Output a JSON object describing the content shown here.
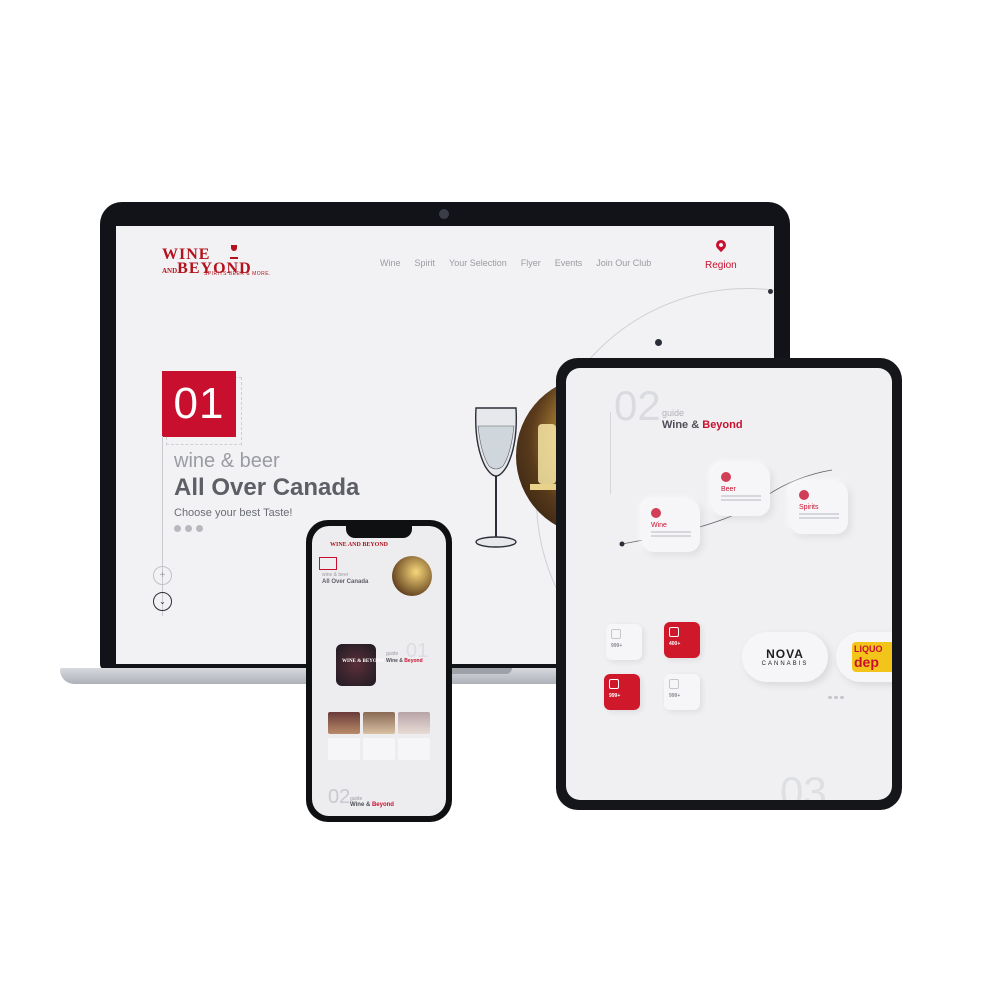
{
  "laptop": {
    "logo": {
      "line1": "WINE",
      "and": "AND",
      "line2": "BEYOND",
      "tagline": "SPIRITS BEER & MORE."
    },
    "nav": [
      "Wine",
      "Spirit",
      "Your Selection",
      "Flyer",
      "Events",
      "Join Our Club"
    ],
    "region_label": "Region",
    "hero": {
      "number": "01",
      "subtitle": "wine & beer",
      "title": "All Over Canada",
      "tagline": "Choose your best Taste!"
    },
    "scroll_up": "+",
    "scroll_down": "⌄",
    "accent": "#c8102e"
  },
  "tablet": {
    "section_number": "02",
    "guide_label": "guide",
    "title_prefix": "Wine & ",
    "title_accent": "Beyond",
    "categories": [
      {
        "label": "Wine"
      },
      {
        "label": "Beer"
      },
      {
        "label": "Spirits"
      }
    ],
    "stats": [
      {
        "value": "999+",
        "highlight": false
      },
      {
        "value": "400+",
        "highlight": true
      },
      {
        "value": "999+",
        "highlight": true
      },
      {
        "value": "999+",
        "highlight": false
      }
    ],
    "brands": {
      "nova_line1": "NOVA",
      "nova_line2": "CANNABIS",
      "liquor_top": "LIQUO",
      "liquor_main": "dep"
    },
    "bottom_number": "03"
  },
  "phone": {
    "logo": "WINE AND BEYOND",
    "hero_sub": "wine & beer",
    "hero_title": "All Over Canada",
    "card_label": "WINE & BEYOND",
    "section_number": "01",
    "guide_label": "guide",
    "title_prefix": "Wine & ",
    "title_accent": "Beyond",
    "section_number_2": "02",
    "guide_label_2": "guide",
    "title2_prefix": "Wine & ",
    "title2_accent": "Beyond"
  }
}
